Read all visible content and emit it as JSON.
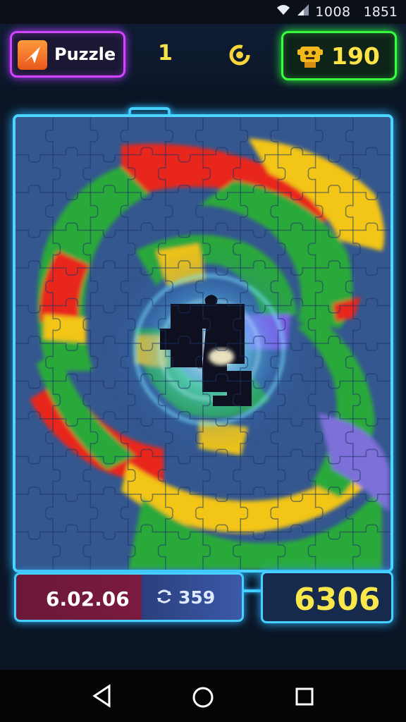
{
  "status_bar": {
    "battery": "1008",
    "time": "1851",
    "icons": [
      "wifi-icon",
      "signal-icon"
    ]
  },
  "header": {
    "app_label": "Puzzle",
    "level": "1",
    "score": "190",
    "icons": [
      "logo-icon",
      "refresh-icon",
      "trophy-icon"
    ]
  },
  "board": {
    "grid_columns": 10,
    "grid_rows": 12,
    "colors": {
      "background": "#33558f",
      "red": "#e8281e",
      "green": "#2ba93a",
      "yellow": "#f2c517",
      "glow": "#4bd5ff"
    }
  },
  "hud": {
    "timer": "6.02.06",
    "moves": "359",
    "total": "6306"
  },
  "colors": {
    "puzzle_button_border": "#d443ff",
    "score_button_border": "#38ff3f",
    "frame_border": "#4bd5ff",
    "accent_yellow": "#f7e24b"
  },
  "nav_bar": {
    "icons": [
      "back-icon",
      "home-icon",
      "recents-icon"
    ]
  }
}
